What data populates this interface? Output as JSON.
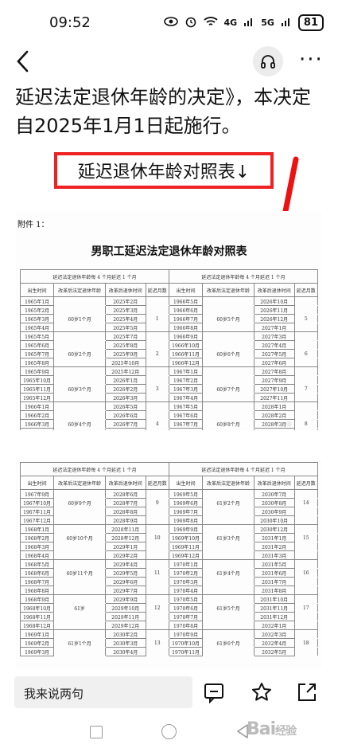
{
  "status": {
    "time": "09:52",
    "signal1": "4G",
    "signal2": "5G",
    "battery": "81"
  },
  "article": {
    "paragraph": "延迟法定退休年龄的决定》，本决定自2025年1月1日起施行。",
    "highlight_label": "延迟退休年龄对照表↓"
  },
  "doc1": {
    "attachment": "附件 1：",
    "title": "男职工延迟法定退休年龄对照表",
    "header_left": "延迟法定退休年龄每 4 个月延迟 1 个月",
    "header_right": "延迟法定退休年龄每 4 个月延迟 1 个月",
    "col_headers": [
      "出生时间",
      "改革后法定退休年龄",
      "改革后退休时间",
      "延迟月数"
    ],
    "left_rows": [
      [
        "1965年1月",
        "",
        "2025年2月",
        ""
      ],
      [
        "1965年2月",
        "",
        "2025年3月",
        ""
      ],
      [
        "1965年3月",
        "60岁1个月",
        "2025年4月",
        "1"
      ],
      [
        "1965年4月",
        "",
        "2025年5月",
        ""
      ],
      [
        "1965年5月",
        "",
        "2025年7月",
        ""
      ],
      [
        "1965年6月",
        "",
        "2025年8月",
        ""
      ],
      [
        "1965年7月",
        "60岁2个月",
        "2025年9月",
        "2"
      ],
      [
        "1965年8月",
        "",
        "2025年10月",
        ""
      ],
      [
        "1965年9月",
        "",
        "2025年12月",
        ""
      ],
      [
        "1965年10月",
        "",
        "2026年1月",
        ""
      ],
      [
        "1965年11月",
        "60岁3个月",
        "2026年2月",
        "3"
      ],
      [
        "1965年12月",
        "",
        "2026年3月",
        ""
      ],
      [
        "1966年1月",
        "",
        "2026年5月",
        ""
      ],
      [
        "1966年2月",
        "",
        "2026年6月",
        ""
      ],
      [
        "1966年3月",
        "60岁4个月",
        "2026年7月",
        "4"
      ],
      [
        "1966年4月",
        "",
        "2026年8月",
        ""
      ]
    ],
    "right_rows": [
      [
        "1966年5月",
        "",
        "2026年10月",
        ""
      ],
      [
        "1966年6月",
        "",
        "2026年11月",
        ""
      ],
      [
        "1966年7月",
        "60岁5个月",
        "2026年12月",
        "5"
      ],
      [
        "1966年8月",
        "",
        "2027年1月",
        ""
      ],
      [
        "1966年9月",
        "",
        "2027年3月",
        ""
      ],
      [
        "1966年10月",
        "",
        "2027年4月",
        ""
      ],
      [
        "1966年11月",
        "60岁6个月",
        "2027年5月",
        "6"
      ],
      [
        "1966年12月",
        "",
        "2027年6月",
        ""
      ],
      [
        "1967年1月",
        "",
        "2027年8月",
        ""
      ],
      [
        "1967年2月",
        "",
        "2027年9月",
        ""
      ],
      [
        "1967年3月",
        "60岁7个月",
        "2027年10月",
        "7"
      ],
      [
        "1967年4月",
        "",
        "2027年11月",
        ""
      ],
      [
        "1967年5月",
        "",
        "2028年1月",
        ""
      ],
      [
        "1967年6月",
        "",
        "2028年2月",
        ""
      ],
      [
        "1967年7月",
        "60岁8个月",
        "2028年3月",
        "8"
      ],
      [
        "1967年8月",
        "",
        "2028年4月",
        ""
      ]
    ]
  },
  "doc2": {
    "header_left": "延迟法定退休年龄每 4 个月延迟 1 个月",
    "header_right": "延迟法定退休年龄每 4 个月延迟 1 个月",
    "col_headers": [
      "出生时间",
      "改革后法定退休年龄",
      "改革后退休时间",
      "延迟月数"
    ],
    "left_rows": [
      [
        "1967年9月",
        "",
        "2028年6月",
        ""
      ],
      [
        "1967年10月",
        "60岁9个月",
        "2028年7月",
        "9"
      ],
      [
        "1967年11月",
        "",
        "2028年8月",
        ""
      ],
      [
        "1967年12月",
        "",
        "2028年9月",
        ""
      ],
      [
        "1968年1月",
        "",
        "2028年11月",
        ""
      ],
      [
        "1968年2月",
        "60岁10个月",
        "2028年12月",
        "10"
      ],
      [
        "1968年3月",
        "",
        "2029年1月",
        ""
      ],
      [
        "1968年4月",
        "",
        "2029年2月",
        ""
      ],
      [
        "1968年5月",
        "",
        "2029年4月",
        ""
      ],
      [
        "1968年6月",
        "60岁11个月",
        "2029年5月",
        "11"
      ],
      [
        "1968年7月",
        "",
        "2029年6月",
        ""
      ],
      [
        "1968年8月",
        "",
        "2029年7月",
        ""
      ],
      [
        "1968年9月",
        "",
        "2029年9月",
        ""
      ],
      [
        "1968年10月",
        "61岁",
        "2029年10月",
        "12"
      ],
      [
        "1968年11月",
        "",
        "2029年11月",
        ""
      ],
      [
        "1968年12月",
        "",
        "2029年12月",
        ""
      ],
      [
        "1969年1月",
        "",
        "2030年2月",
        ""
      ],
      [
        "1969年2月",
        "61岁1个月",
        "2030年3月",
        "13"
      ],
      [
        "1969年3月",
        "",
        "2030年4月",
        ""
      ]
    ],
    "right_rows": [
      [
        "1969年5月",
        "",
        "2030年7月",
        ""
      ],
      [
        "1969年6月",
        "61岁2个月",
        "2030年8月",
        "14"
      ],
      [
        "1969年7月",
        "",
        "2030年9月",
        ""
      ],
      [
        "1969年8月",
        "",
        "2030年10月",
        ""
      ],
      [
        "1969年9月",
        "",
        "2030年12月",
        ""
      ],
      [
        "1969年10月",
        "61岁3个月",
        "2031年1月",
        "15"
      ],
      [
        "1969年11月",
        "",
        "2031年2月",
        ""
      ],
      [
        "1969年12月",
        "",
        "2031年3月",
        ""
      ],
      [
        "1970年1月",
        "",
        "2031年5月",
        ""
      ],
      [
        "1970年2月",
        "61岁4个月",
        "2031年6月",
        "16"
      ],
      [
        "1970年3月",
        "",
        "2031年7月",
        ""
      ],
      [
        "1970年4月",
        "",
        "2031年8月",
        ""
      ],
      [
        "1970年5月",
        "",
        "2031年10月",
        ""
      ],
      [
        "1970年6月",
        "61岁5个月",
        "2031年11月",
        "17"
      ],
      [
        "1970年7月",
        "",
        "2031年12月",
        ""
      ],
      [
        "1970年8月",
        "",
        "2032年1月",
        ""
      ],
      [
        "1970年9月",
        "",
        "2032年3月",
        ""
      ],
      [
        "1970年10月",
        "61岁6个月",
        "2032年4月",
        "18"
      ],
      [
        "1970年11月",
        "",
        "2032年5月",
        ""
      ]
    ]
  },
  "bottom": {
    "comment_placeholder": "我来说两句"
  },
  "brand": {
    "text": "Bai",
    "suffix": "经验"
  }
}
